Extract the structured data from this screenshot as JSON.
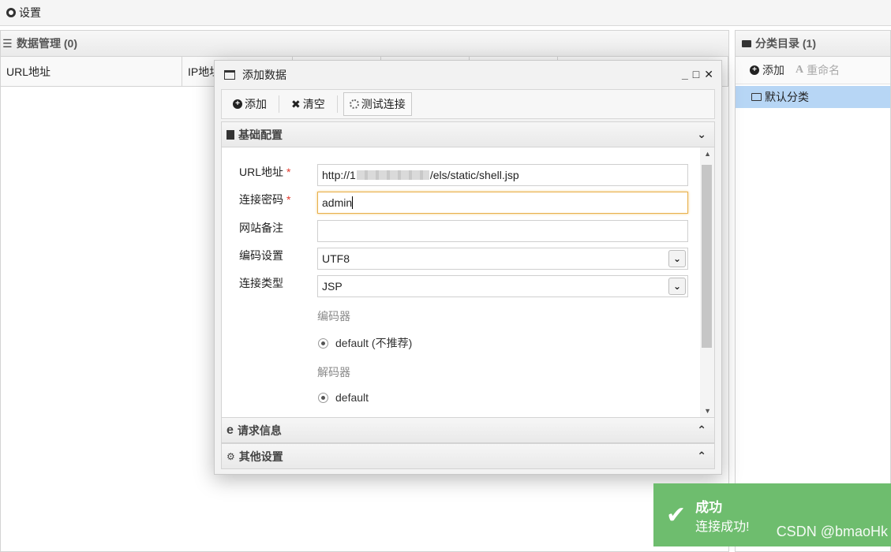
{
  "topbar": {
    "settings_label": "设置"
  },
  "data_panel": {
    "title": "数据管理 (0)",
    "columns": [
      "URL地址",
      "IP地址",
      "",
      "",
      "",
      ""
    ]
  },
  "category_panel": {
    "title": "分类目录 (1)",
    "add_label": "添加",
    "rename_label": "重命名",
    "items": [
      {
        "label": "默认分类"
      }
    ]
  },
  "modal": {
    "title": "添加数据",
    "toolbar": {
      "add_label": "添加",
      "clear_label": "清空",
      "test_label": "测试连接"
    },
    "basic_section": "基础配置",
    "form": {
      "url_label": "URL地址",
      "url_value_prefix": "http://1",
      "url_value_suffix": "/els/static/shell.jsp",
      "password_label": "连接密码",
      "password_value": "admin",
      "note_label": "网站备注",
      "note_value": "",
      "encoding_label": "编码设置",
      "encoding_value": "UTF8",
      "type_label": "连接类型",
      "type_value": "JSP",
      "encoder_label": "编码器",
      "encoder_option": "default (不推荐)",
      "decoder_label": "解码器",
      "decoder_option": "default",
      "required_mark": "*"
    },
    "request_section": "请求信息",
    "other_section": "其他设置"
  },
  "toast": {
    "title": "成功",
    "message": "连接成功!"
  },
  "watermark": "CSDN @bmaoHk",
  "colors": {
    "toast_bg": "#6ebd6e",
    "selected_bg": "#b7d6f5",
    "required": "#e2382c",
    "focus_border": "#e8b04c"
  }
}
